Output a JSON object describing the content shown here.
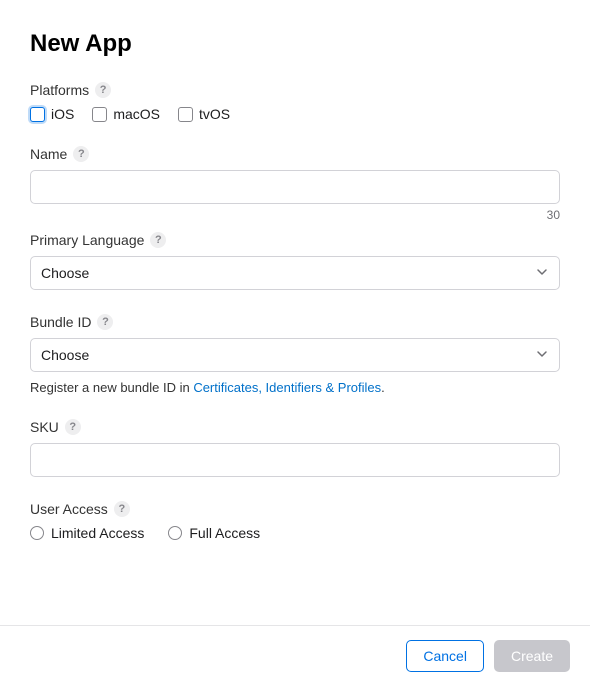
{
  "title": "New App",
  "platforms": {
    "label": "Platforms",
    "options": {
      "ios": "iOS",
      "macos": "macOS",
      "tvos": "tvOS"
    }
  },
  "name": {
    "label": "Name",
    "value": "",
    "counter": "30"
  },
  "primaryLanguage": {
    "label": "Primary Language",
    "selected": "Choose"
  },
  "bundleId": {
    "label": "Bundle ID",
    "selected": "Choose",
    "hintPrefix": "Register a new bundle ID in ",
    "hintLink": "Certificates, Identifiers & Profiles",
    "hintSuffix": "."
  },
  "sku": {
    "label": "SKU",
    "value": ""
  },
  "userAccess": {
    "label": "User Access",
    "options": {
      "limited": "Limited Access",
      "full": "Full Access"
    }
  },
  "footer": {
    "cancel": "Cancel",
    "create": "Create"
  },
  "helpGlyph": "?"
}
